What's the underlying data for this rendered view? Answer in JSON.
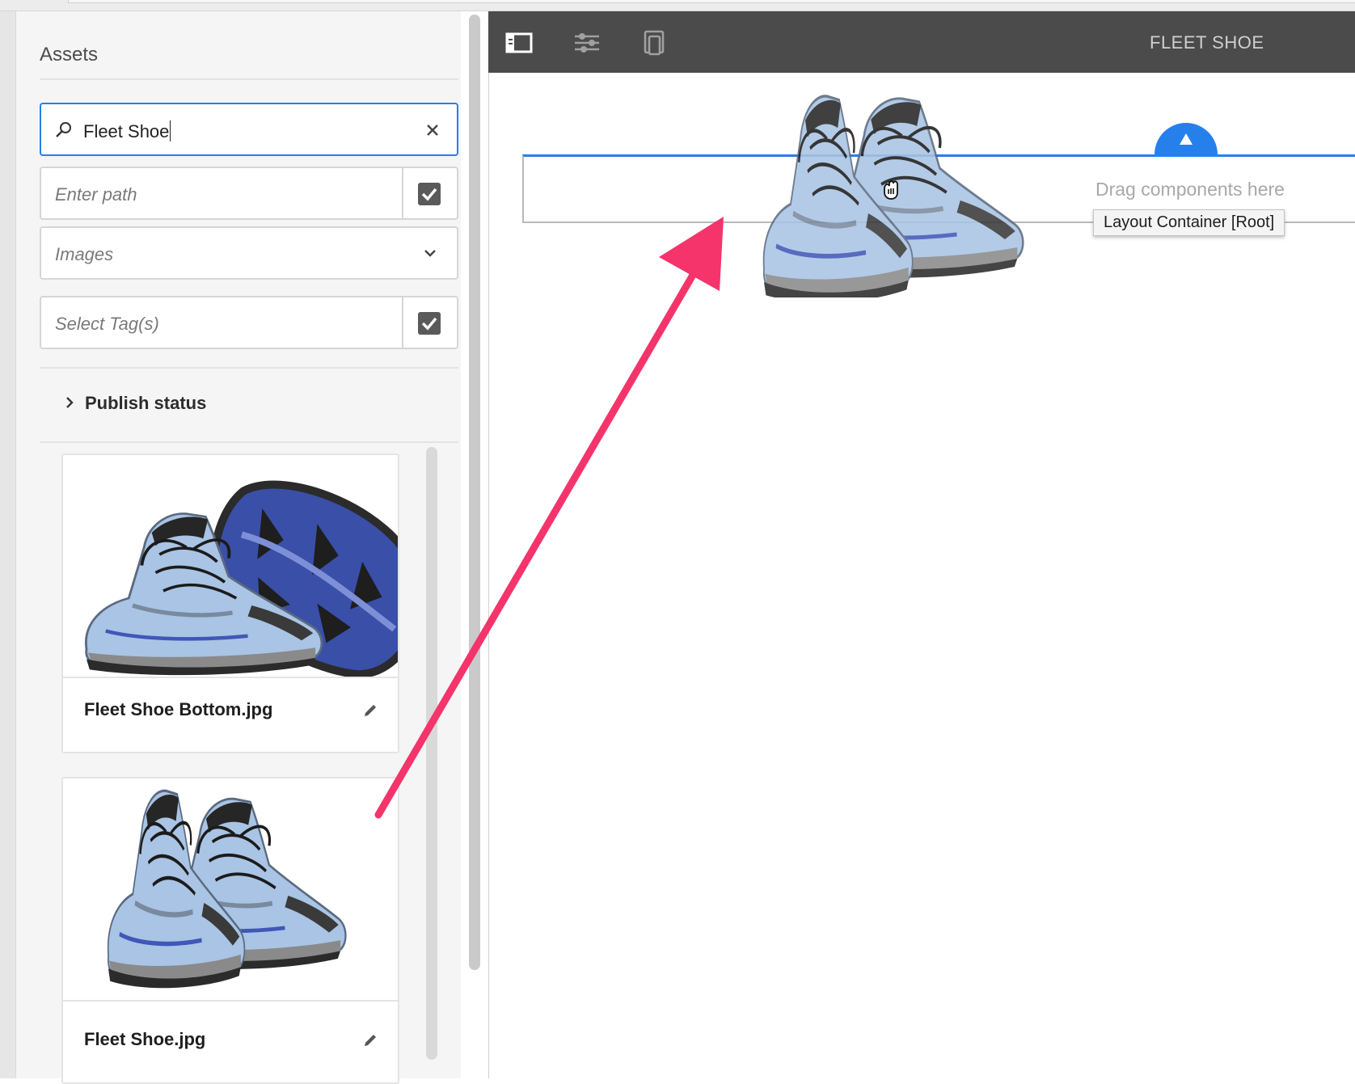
{
  "panel": {
    "title": "Assets",
    "search": {
      "value": "Fleet Shoe"
    },
    "path": {
      "placeholder": "Enter path"
    },
    "type_select": {
      "placeholder": "Images"
    },
    "tags": {
      "placeholder": "Select Tag(s)"
    },
    "publish_status": {
      "label": "Publish status"
    },
    "assets": [
      {
        "name": "Fleet Shoe Bottom.jpg"
      },
      {
        "name": "Fleet Shoe.jpg"
      }
    ]
  },
  "toolbar": {
    "page_title": "FLEET SHOE"
  },
  "canvas": {
    "drop_hint": "Drag components here",
    "container_tooltip": "Layout Container [Root]"
  },
  "colors": {
    "accent": "#2680eb",
    "toolbar_bg": "#4b4b4b",
    "annotation_arrow": "#f4346b"
  },
  "icons": [
    "search-icon",
    "clear-icon",
    "checkbox-icon",
    "chevron-down-icon",
    "chevron-right-icon",
    "edit-icon",
    "side-panel-icon",
    "page-properties-icon",
    "emulator-icon",
    "insert-icon",
    "grab-cursor-icon"
  ]
}
